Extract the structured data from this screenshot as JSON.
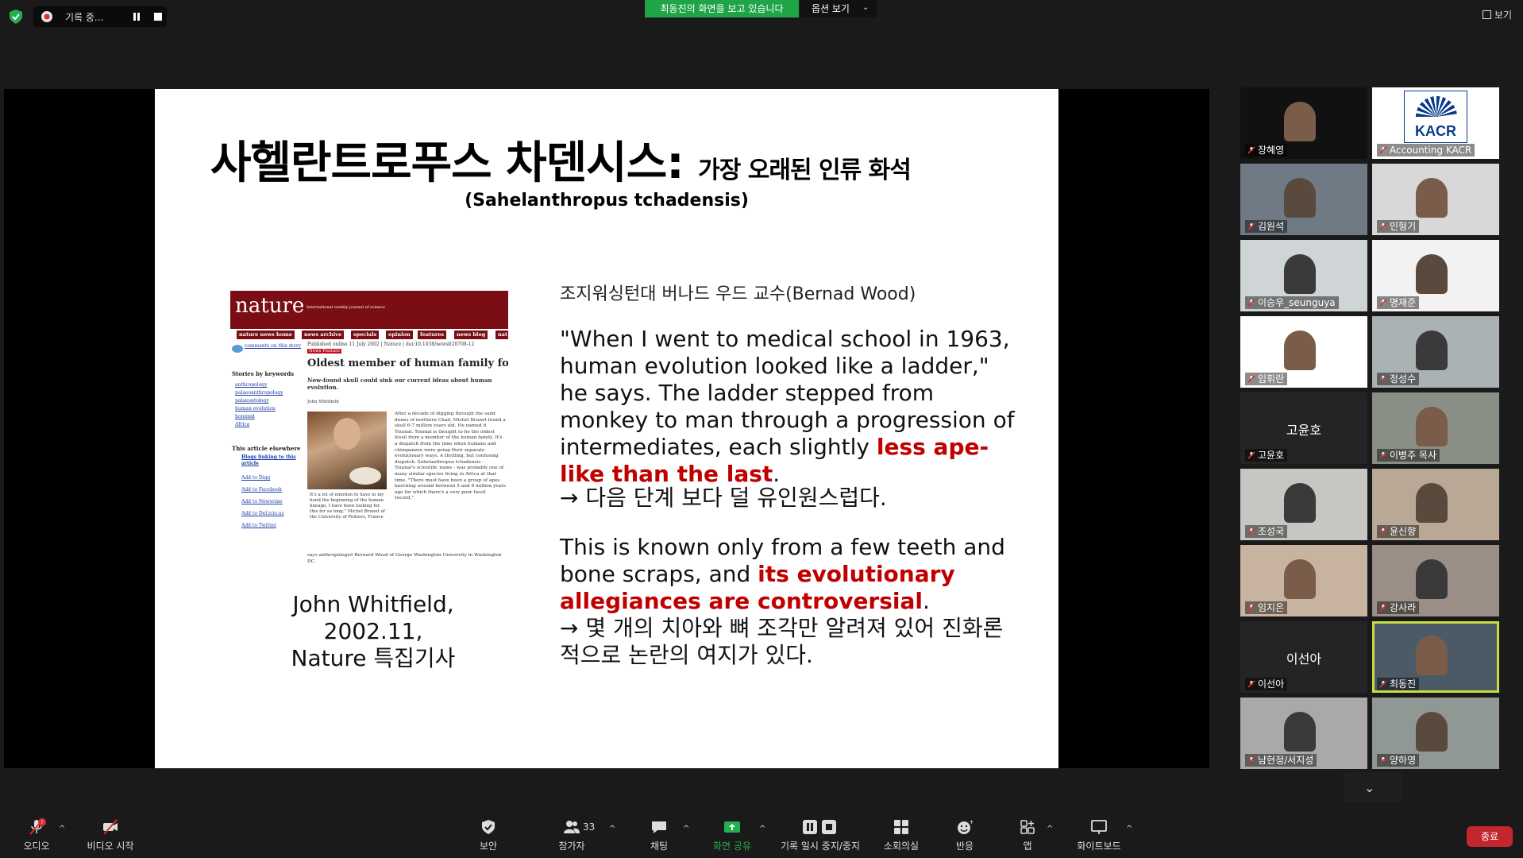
{
  "topbar": {
    "recording_label": "기록 중...",
    "share_banner": "최동진의 화면을 보고 있습니다",
    "view_options": "옵션 보기",
    "view_button": "보기"
  },
  "slide": {
    "title_main": "사헬란트로푸스 차덴시스:",
    "title_sub": "가장 오래된 인류 화석",
    "latin_name": "(Sahelanthropus tchadensis)",
    "source_person": "조지워싱턴대 버나드 우드 교수(Bernad Wood)",
    "quote1_en_a": "\"When I went to medical school in 1963, human evolution looked like a ladder,\" he says. The ladder stepped from monkey to man through a progression of intermediates, each slightly ",
    "quote1_en_em": "less ape-like than the last",
    "quote1_en_b": ".",
    "quote1_ko": "→ 다음 단계 보다 덜 유인원스럽다.",
    "quote2_en_a": "This is known only from a few teeth and bone scraps, and ",
    "quote2_en_em": "its evolutionary allegiances are controversial",
    "quote2_en_b": ".",
    "quote2_ko": "→ 몇 개의 치아와 뼈 조각만 알려져 있어 진화론적으로 논란의 여지가 있다.",
    "caption_1": "John Whitfield,",
    "caption_2": "2002.11,",
    "caption_3": "Nature 특집기사",
    "clipping": {
      "logo": "nature",
      "tagline": "International weekly journal of science",
      "nav": [
        "nature news home",
        "news archive",
        "specials",
        "opinion",
        "features",
        "news blog",
        "nat"
      ],
      "comments": "comments on this story",
      "published": "Published online 11 July 2002 | Nature | doi:10.1038/news020708-12",
      "feature_tag": "News Feature",
      "headline": "Oldest member of human family found",
      "deck": "Now-found skull could sink our current ideas about human evolution.",
      "author": "John Whitfield",
      "keywords_title": "Stories by keywords",
      "keywords": [
        "anthropology",
        "palaeoanthropology",
        "palaeontology",
        "human evolution",
        "hominid",
        "Africa"
      ],
      "elsewhere_title": "This article elsewhere",
      "elsewhere": [
        "Blogs linking to this article",
        "Add to Digg",
        "Add to Facebook",
        "Add to Newsvine",
        "Add to Del.icio.us",
        "Add to Twitter"
      ],
      "photo_caption": "It's a lot of emotion to have in my hand the beginning of the human lineage. I have been looking for this for so long.\" Michel Brunet of the University of Poitiers, France",
      "body": "After a decade of digging through the sand dunes of northern Chad, Michel Brunet found a skull 6-7 million years old. He named it Toumaï. Toumaï is thought to be the oldest fossil from a member of the human family. It's a dispatch from the time when humans and chimpanzee were going their separate evolutionary ways. A thrilling, but confusing dispatch. Sahelanthropus tchadensis - Toumaï's scientific name - was probably one of many similar species living in Africa at that time. \"There must have been a group of apes knocking around between 5 and 8 million years ago for which there's a very poor fossil record,\"",
      "foot": "says anthropologist Bernard Wood of George Washington University in Washington DC."
    }
  },
  "gallery": {
    "tiles": [
      {
        "name": "장혜영"
      },
      {
        "name": "Accounting KACR",
        "logo": "KACR"
      },
      {
        "name": "김원석"
      },
      {
        "name": "민형기"
      },
      {
        "name": "이승우_seunguya"
      },
      {
        "name": "명재준"
      },
      {
        "name": "임휘란"
      },
      {
        "name": "정성수"
      },
      {
        "name": "고윤호",
        "big": "고윤호"
      },
      {
        "name": "이병주 목사"
      },
      {
        "name": "조성국"
      },
      {
        "name": "윤신향"
      },
      {
        "name": "임지은"
      },
      {
        "name": "강사라"
      },
      {
        "name": "이선아",
        "big": "이선아"
      },
      {
        "name": "최동진"
      },
      {
        "name": "남현정/서지성"
      },
      {
        "name": "양하영"
      }
    ]
  },
  "toolbar": {
    "audio": "오디오",
    "audio_badge": "!",
    "video": "비디오 시작",
    "security": "보안",
    "participants": "참가자",
    "participants_count": "33",
    "chat": "채팅",
    "share_screen": "화면 공유",
    "record": "기록 일시 중지/중지",
    "breakout": "소회의실",
    "reactions": "반응",
    "apps": "앱",
    "whiteboard": "화이트보드",
    "end": "종료"
  },
  "colors": {
    "share_green": "#1fa548",
    "end_red": "#c4262e",
    "active_speaker": "#c9de3c",
    "nature_red": "#7a0e14",
    "emphasis_red": "#c00000"
  }
}
